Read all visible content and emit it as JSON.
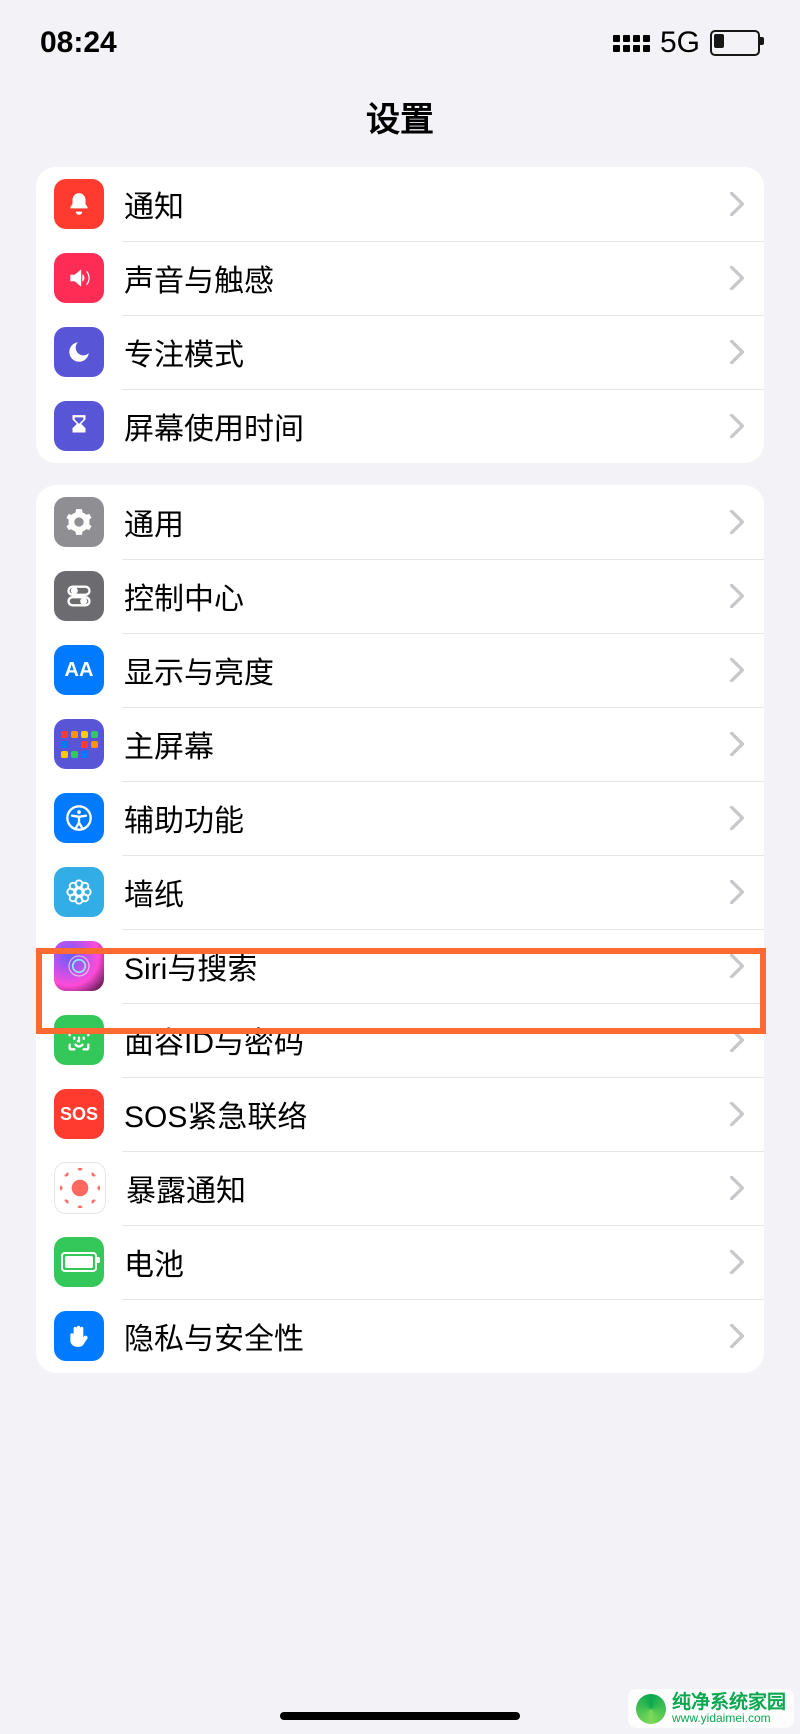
{
  "statusbar": {
    "time": "08:24",
    "network": "5G"
  },
  "header": {
    "title": "设置"
  },
  "groups": [
    {
      "rows": [
        {
          "id": "notifications",
          "label": "通知"
        },
        {
          "id": "sounds",
          "label": "声音与触感"
        },
        {
          "id": "focus",
          "label": "专注模式"
        },
        {
          "id": "screentime",
          "label": "屏幕使用时间"
        }
      ]
    },
    {
      "rows": [
        {
          "id": "general",
          "label": "通用"
        },
        {
          "id": "controlcenter",
          "label": "控制中心"
        },
        {
          "id": "display",
          "label": "显示与亮度"
        },
        {
          "id": "homescreen",
          "label": "主屏幕"
        },
        {
          "id": "accessibility",
          "label": "辅助功能"
        },
        {
          "id": "wallpaper",
          "label": "墙纸",
          "highlighted": true
        },
        {
          "id": "siri",
          "label": "Siri与搜索"
        },
        {
          "id": "faceid",
          "label": "面容ID与密码"
        },
        {
          "id": "sos",
          "label": "SOS紧急联络"
        },
        {
          "id": "exposure",
          "label": "暴露通知"
        },
        {
          "id": "battery",
          "label": "电池"
        },
        {
          "id": "privacy",
          "label": "隐私与安全性"
        }
      ]
    }
  ],
  "watermark": {
    "text": "纯净系统家园",
    "url": "www.yidaimei.com"
  }
}
